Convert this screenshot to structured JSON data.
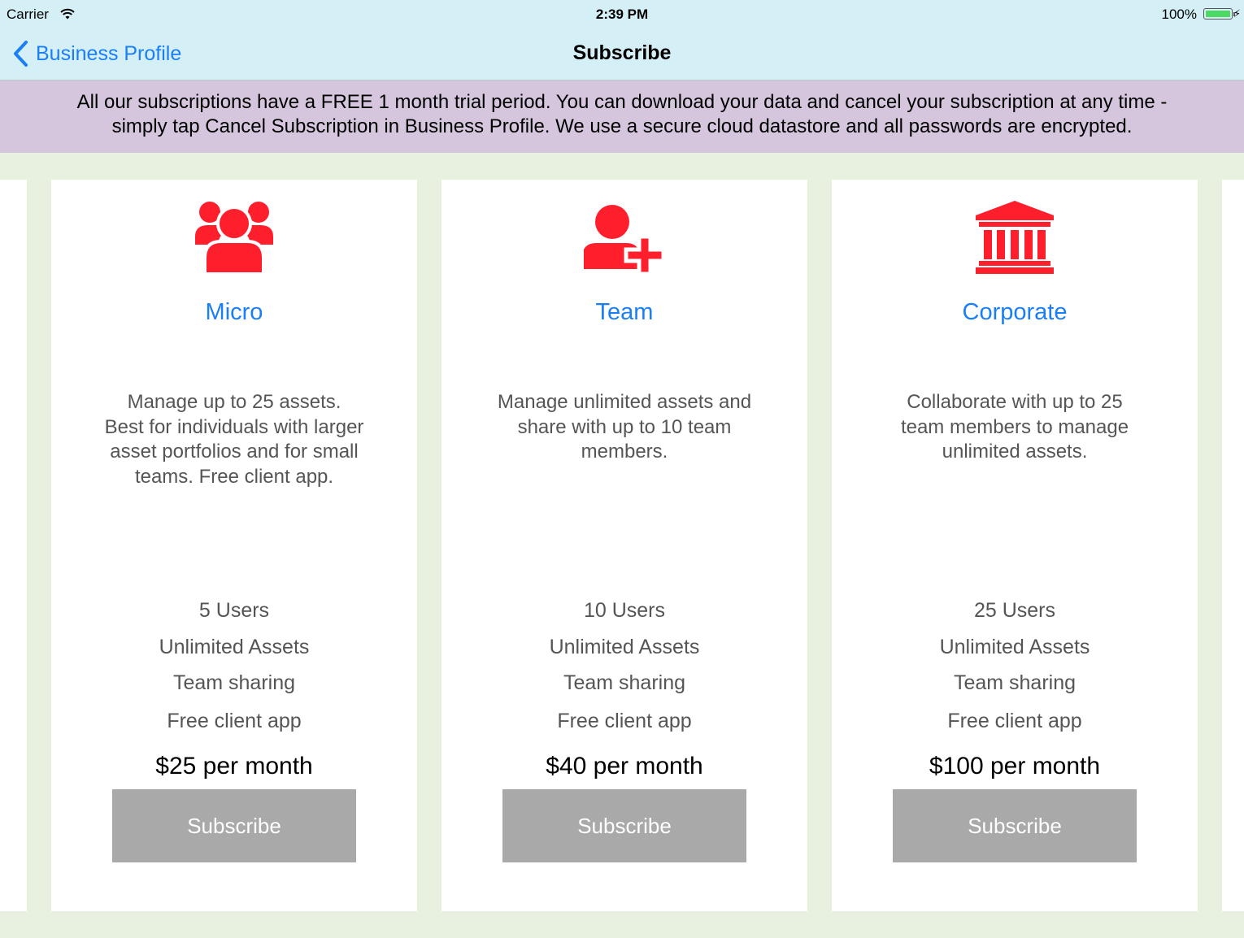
{
  "status_bar": {
    "carrier": "Carrier",
    "time": "2:39 PM",
    "battery": "100%"
  },
  "nav": {
    "back_label": "Business Profile",
    "title": "Subscribe"
  },
  "banner": {
    "line1": "All our subscriptions have a FREE 1 month trial period.  You can download your data and cancel your subscription at any time -",
    "line2": "simply tap Cancel Subscription in Business Profile.  We use a secure cloud datastore and all passwords are encrypted."
  },
  "colors": {
    "accent": "#1a7ff5",
    "icon": "#ff1e2c",
    "button": "#a9a9a9",
    "banner": "#d5c6de",
    "navbar": "#d4eff6",
    "background": "#e8f1df"
  },
  "plans": [
    {
      "icon": "group-icon",
      "name": "Micro",
      "desc": [
        "Manage up to 25 assets.",
        "Best for individuals with larger",
        "asset portfolios and for small",
        "teams.  Free client app."
      ],
      "features": [
        "5 Users",
        "Unlimited Assets",
        "Team sharing",
        "Free client app"
      ],
      "price": "$25 per month",
      "button": "Subscribe"
    },
    {
      "icon": "add-user-icon",
      "name": "Team",
      "desc": [
        "Manage unlimited assets and",
        "share with up to 10 team",
        "members."
      ],
      "features": [
        "10 Users",
        "Unlimited Assets",
        "Team sharing",
        "Free client app"
      ],
      "price": "$40 per month",
      "button": "Subscribe"
    },
    {
      "icon": "bank-building-icon",
      "name": "Corporate",
      "desc": [
        "Collaborate with up to 25",
        "team members to manage",
        "unlimited assets."
      ],
      "features": [
        "25 Users",
        "Unlimited Assets",
        "Team sharing",
        "Free client app"
      ],
      "price": "$100 per month",
      "button": "Subscribe"
    }
  ]
}
